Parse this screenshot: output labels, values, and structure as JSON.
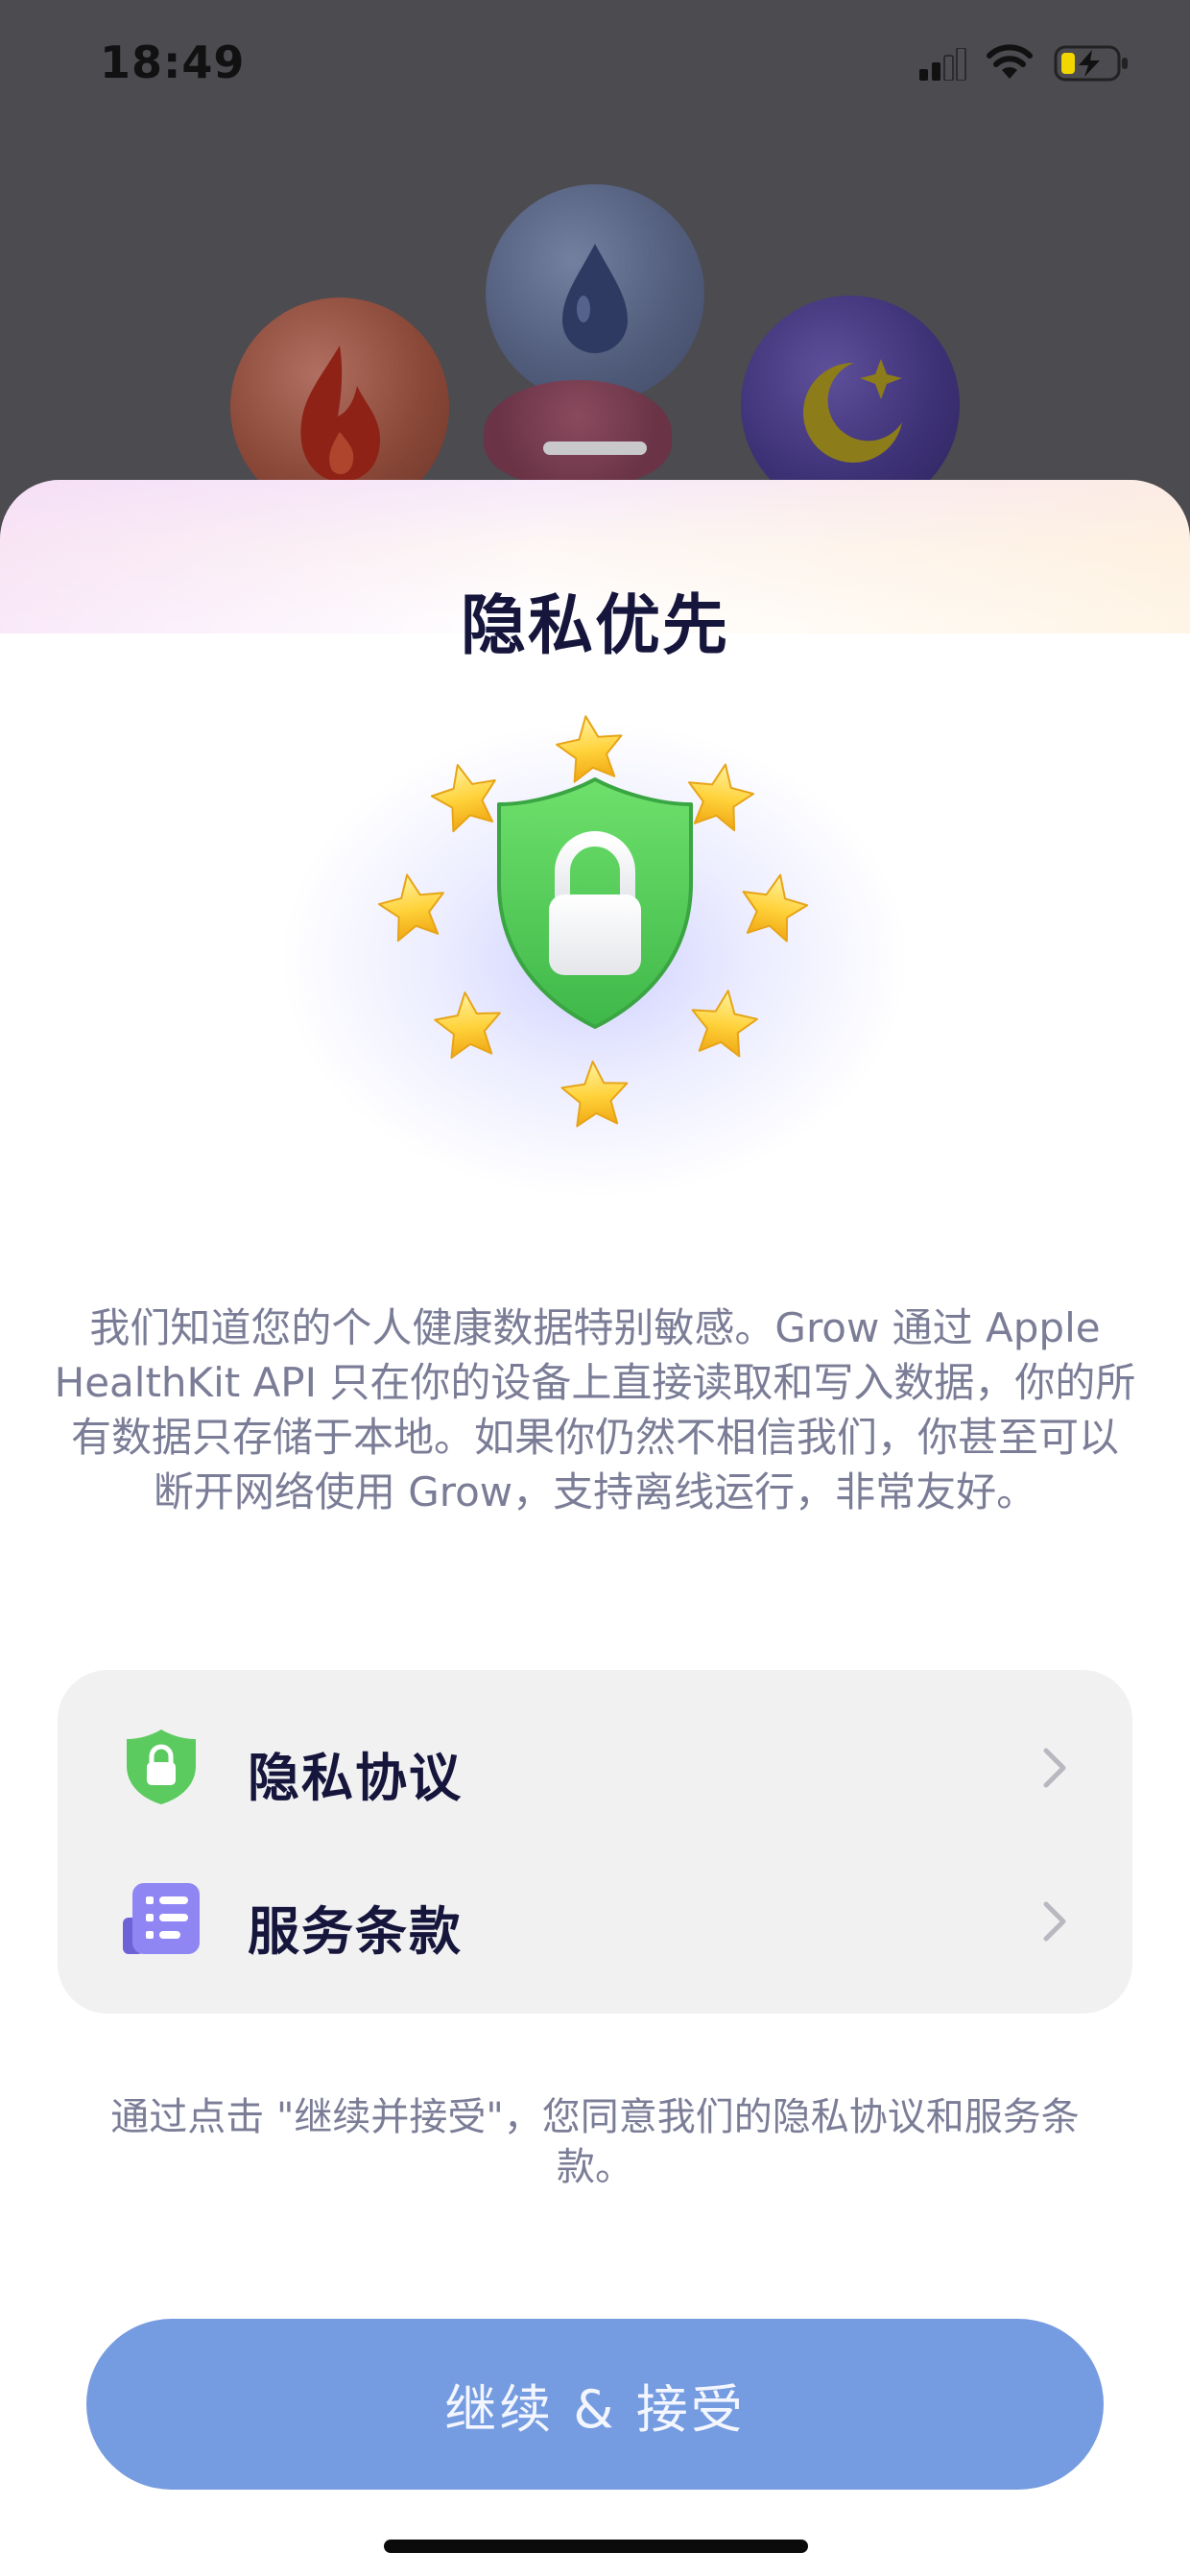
{
  "status_bar": {
    "time": "18:49",
    "signal_icon": "cellular-signal-icon",
    "wifi_icon": "wifi-icon",
    "battery_icon": "battery-charging-icon"
  },
  "background_app": {
    "orbs": [
      "flame-icon",
      "water-drop-icon",
      "moon-star-icon"
    ]
  },
  "sheet": {
    "title": "隐私优先",
    "hero_icon": "shield-lock-with-stars-icon",
    "description": "我们知道您的个人健康数据特别敏感。Grow 通过 Apple HealthKit API 只在你的设备上直接读取和写入数据，你的所有数据只存储于本地。如果你仍然不相信我们，你甚至可以断开网络使用 Grow，支持离线运行，非常友好。",
    "links": [
      {
        "label": "隐私协议",
        "icon": "shield-lock-icon"
      },
      {
        "label": "服务条款",
        "icon": "document-list-icon"
      }
    ],
    "consent_text": "通过点击 \"继续并接受\"，您同意我们的隐私协议和服务条款。",
    "cta_label": "继续 & 接受"
  },
  "colors": {
    "cta": "#759be0",
    "title": "#16163d",
    "secondary_text": "#7b7d97",
    "shield_green": "#5ccb5f",
    "terms_icon": "#8f86f3"
  }
}
